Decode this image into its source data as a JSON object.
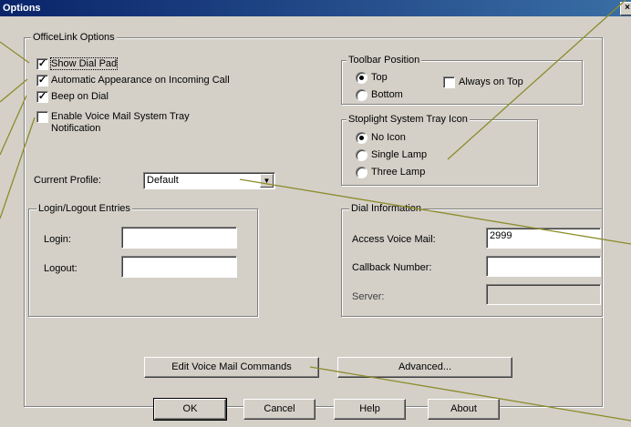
{
  "window": {
    "title": "Options",
    "close_glyph": "×"
  },
  "officelink": {
    "legend": "OfficeLink Options",
    "options": [
      {
        "label": "Show Dial Pad",
        "checked": true
      },
      {
        "label": "Automatic Appearance on Incoming Call",
        "checked": true
      },
      {
        "label": "Beep on Dial",
        "checked": true
      },
      {
        "label": "Enable Voice Mail System Tray",
        "label2": "Notification",
        "checked": false
      }
    ],
    "check_glyph": "✓"
  },
  "toolbar_position": {
    "legend": "Toolbar Position",
    "top_label": "Top",
    "bottom_label": "Bottom",
    "selected": "Top",
    "always_on_top_label": "Always on Top",
    "always_on_top_checked": false
  },
  "stoplight": {
    "legend": "Stoplight System Tray Icon",
    "options": [
      "No Icon",
      "Single Lamp",
      "Three Lamp"
    ],
    "selected": "No Icon"
  },
  "profile": {
    "label": "Current Profile:",
    "value": "Default",
    "arrow_glyph": "▼"
  },
  "login": {
    "legend": "Login/Logout Entries",
    "login_label": "Login:",
    "logout_label": "Logout:",
    "login_value": "",
    "logout_value": ""
  },
  "dial": {
    "legend": "Dial Information",
    "access_label": "Access Voice Mail:",
    "access_value": "2999",
    "callback_label": "Callback Number:",
    "callback_value": "",
    "server_label": "Server:",
    "server_value": ""
  },
  "buttons": {
    "edit_vm": "Edit Voice Mail Commands",
    "advanced": "Advanced...",
    "ok": "OK",
    "cancel": "Cancel",
    "help": "Help",
    "about": "About"
  },
  "colors": {
    "titlebar_start": "#0a246a",
    "titlebar_end": "#3a6ea5",
    "face": "#d4d0c8",
    "callout_line": "#8c8c2c"
  }
}
